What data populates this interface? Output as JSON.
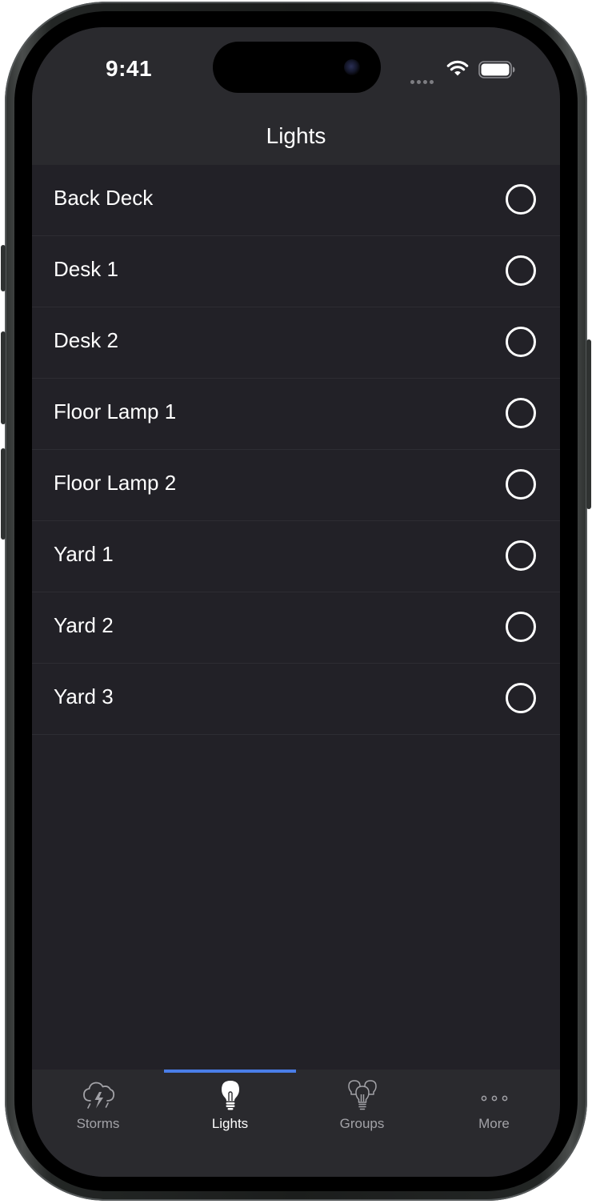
{
  "status_bar": {
    "time": "9:41"
  },
  "navigation": {
    "title": "Lights"
  },
  "lights": [
    {
      "label": "Back Deck",
      "selected": false
    },
    {
      "label": "Desk 1",
      "selected": false
    },
    {
      "label": "Desk 2",
      "selected": false
    },
    {
      "label": "Floor Lamp 1",
      "selected": false
    },
    {
      "label": "Floor Lamp 2",
      "selected": false
    },
    {
      "label": "Yard 1",
      "selected": false
    },
    {
      "label": "Yard 2",
      "selected": false
    },
    {
      "label": "Yard 3",
      "selected": false
    }
  ],
  "tab_bar": {
    "active": "Lights",
    "items": [
      {
        "label": "Storms",
        "icon": "storm-cloud-icon"
      },
      {
        "label": "Lights",
        "icon": "lightbulb-icon"
      },
      {
        "label": "Groups",
        "icon": "lightbulb-group-icon"
      },
      {
        "label": "More",
        "icon": "more-dots-icon"
      }
    ]
  },
  "colors": {
    "background": "#222127",
    "bar_background": "#2a2a2e",
    "accent": "#4a7ee8",
    "text": "#ffffff",
    "inactive_tab": "#a2a2a7"
  }
}
